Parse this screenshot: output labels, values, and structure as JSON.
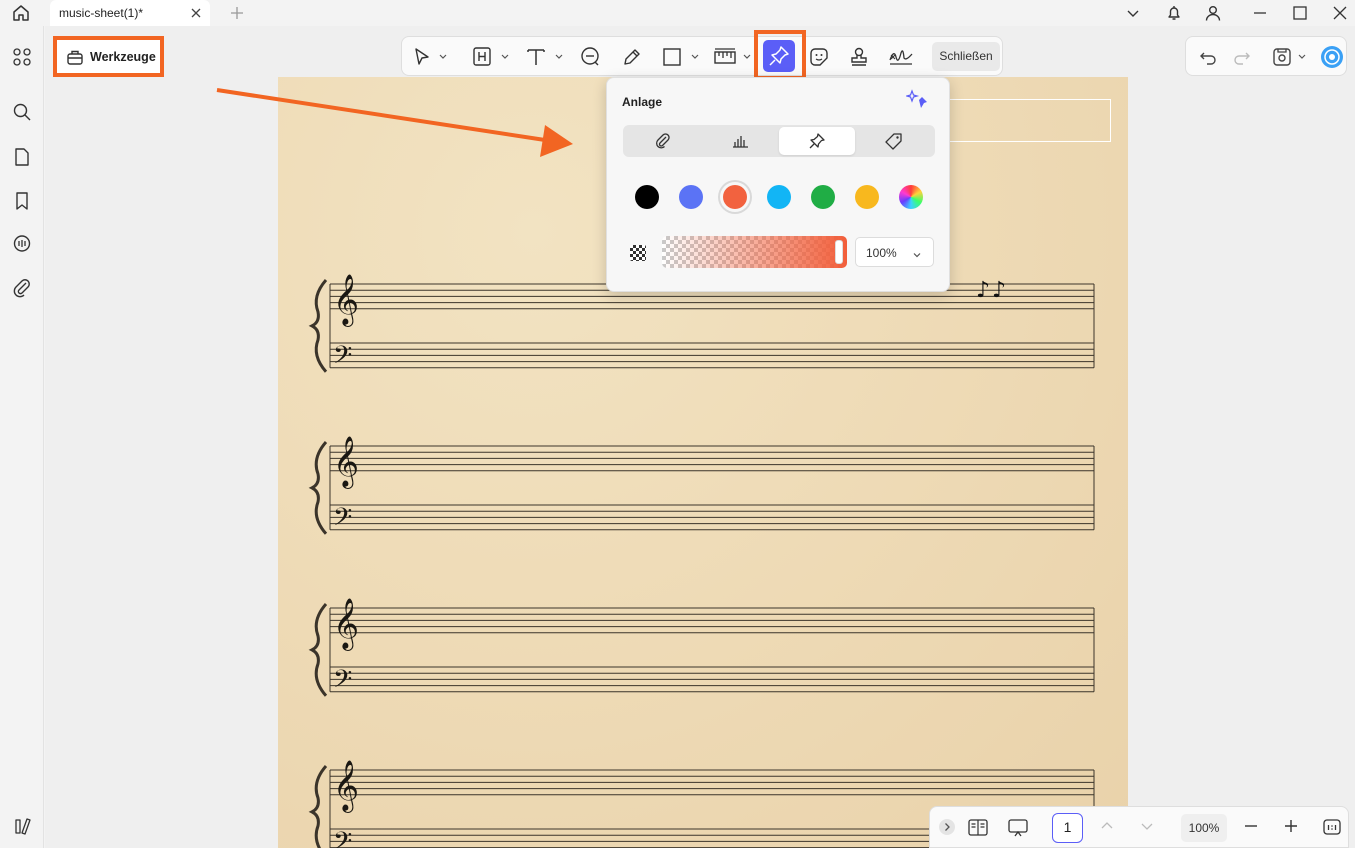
{
  "app": {
    "tab_title": "music-sheet(1)*"
  },
  "toolbar": {
    "werkzeuge_label": "Werkzeuge",
    "close_label": "Schließen"
  },
  "popup": {
    "title": "Anlage",
    "segments": [
      "attachment",
      "chart",
      "pin",
      "tag"
    ],
    "active_segment": "pin",
    "colors": [
      "#000000",
      "#5b73f5",
      "#f2623f",
      "#12b5f5",
      "#20ad45",
      "#f8b81e",
      "rainbow"
    ],
    "selected_color": "#f2623f",
    "opacity": "100%"
  },
  "statusbar": {
    "page_number": "1",
    "zoom": "100%"
  },
  "icons": {
    "accent": "#5b5ef7",
    "highlight": "#f26522"
  }
}
